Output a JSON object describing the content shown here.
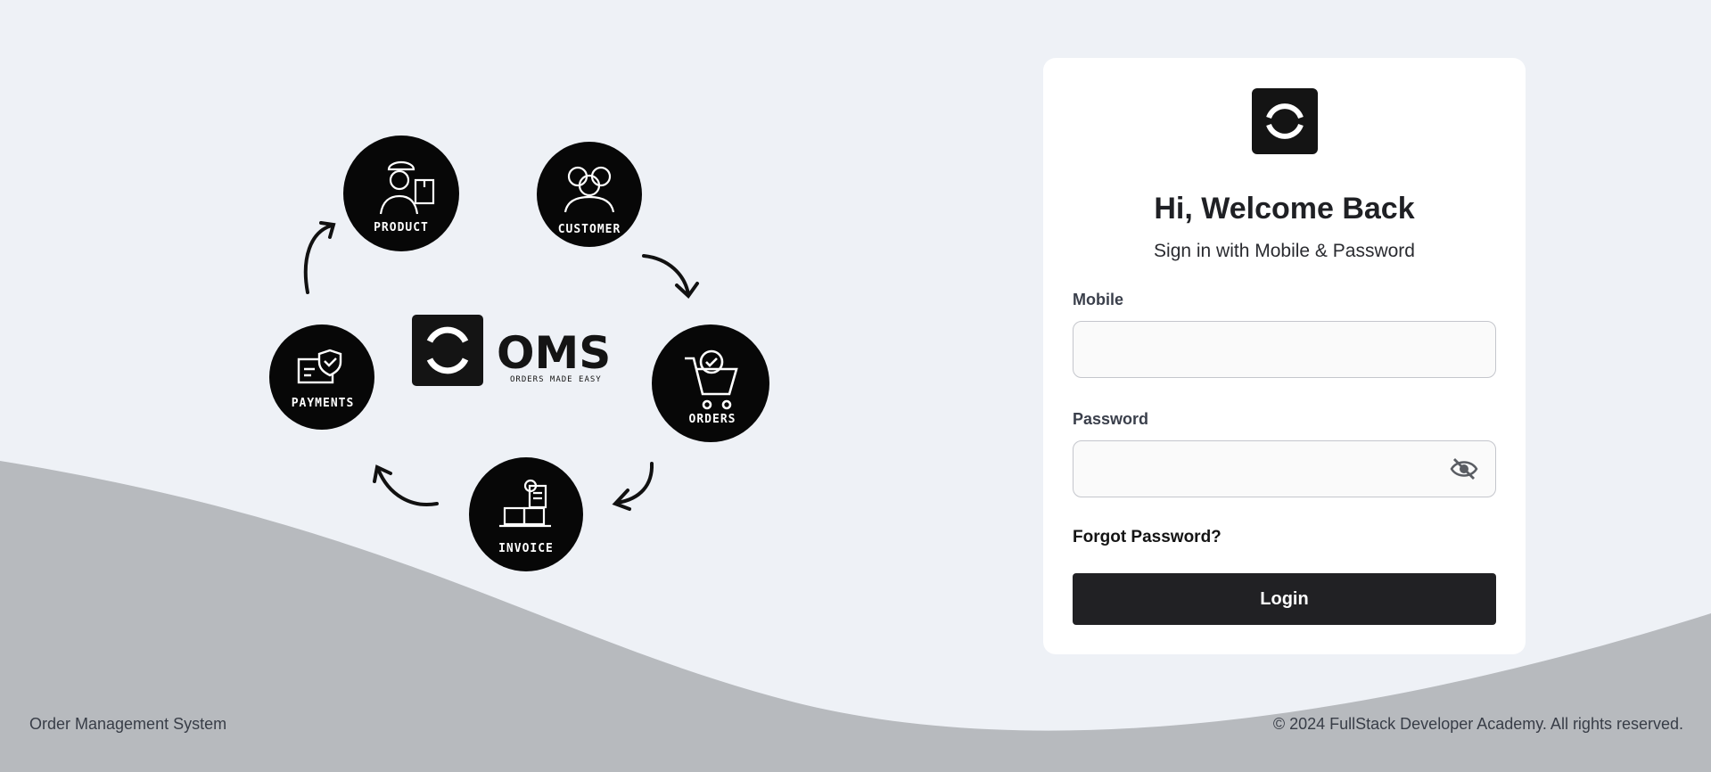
{
  "hero": {
    "brand": {
      "name": "OMS",
      "tagline": "ORDERS MADE EASY"
    },
    "nodes": [
      {
        "label": "PRODUCT",
        "icon": "delivery-person-icon"
      },
      {
        "label": "CUSTOMER",
        "icon": "people-icon"
      },
      {
        "label": "ORDERS",
        "icon": "cart-icon"
      },
      {
        "label": "INVOICE",
        "icon": "boxes-document-icon"
      },
      {
        "label": "PAYMENTS",
        "icon": "shield-card-icon"
      }
    ]
  },
  "login": {
    "title": "Hi, Welcome Back",
    "subtitle": "Sign in with Mobile & Password",
    "mobile_label": "Mobile",
    "mobile_value": "",
    "password_label": "Password",
    "password_value": "",
    "forgot_label": "Forgot Password?",
    "submit_label": "Login"
  },
  "footer": {
    "left": "Order Management System",
    "right": "© 2024 FullStack Developer Academy. All rights reserved."
  },
  "colors": {
    "background": "#eef1f6",
    "wave": "#b7babe",
    "primary": "#212124",
    "card": "#ffffff"
  }
}
